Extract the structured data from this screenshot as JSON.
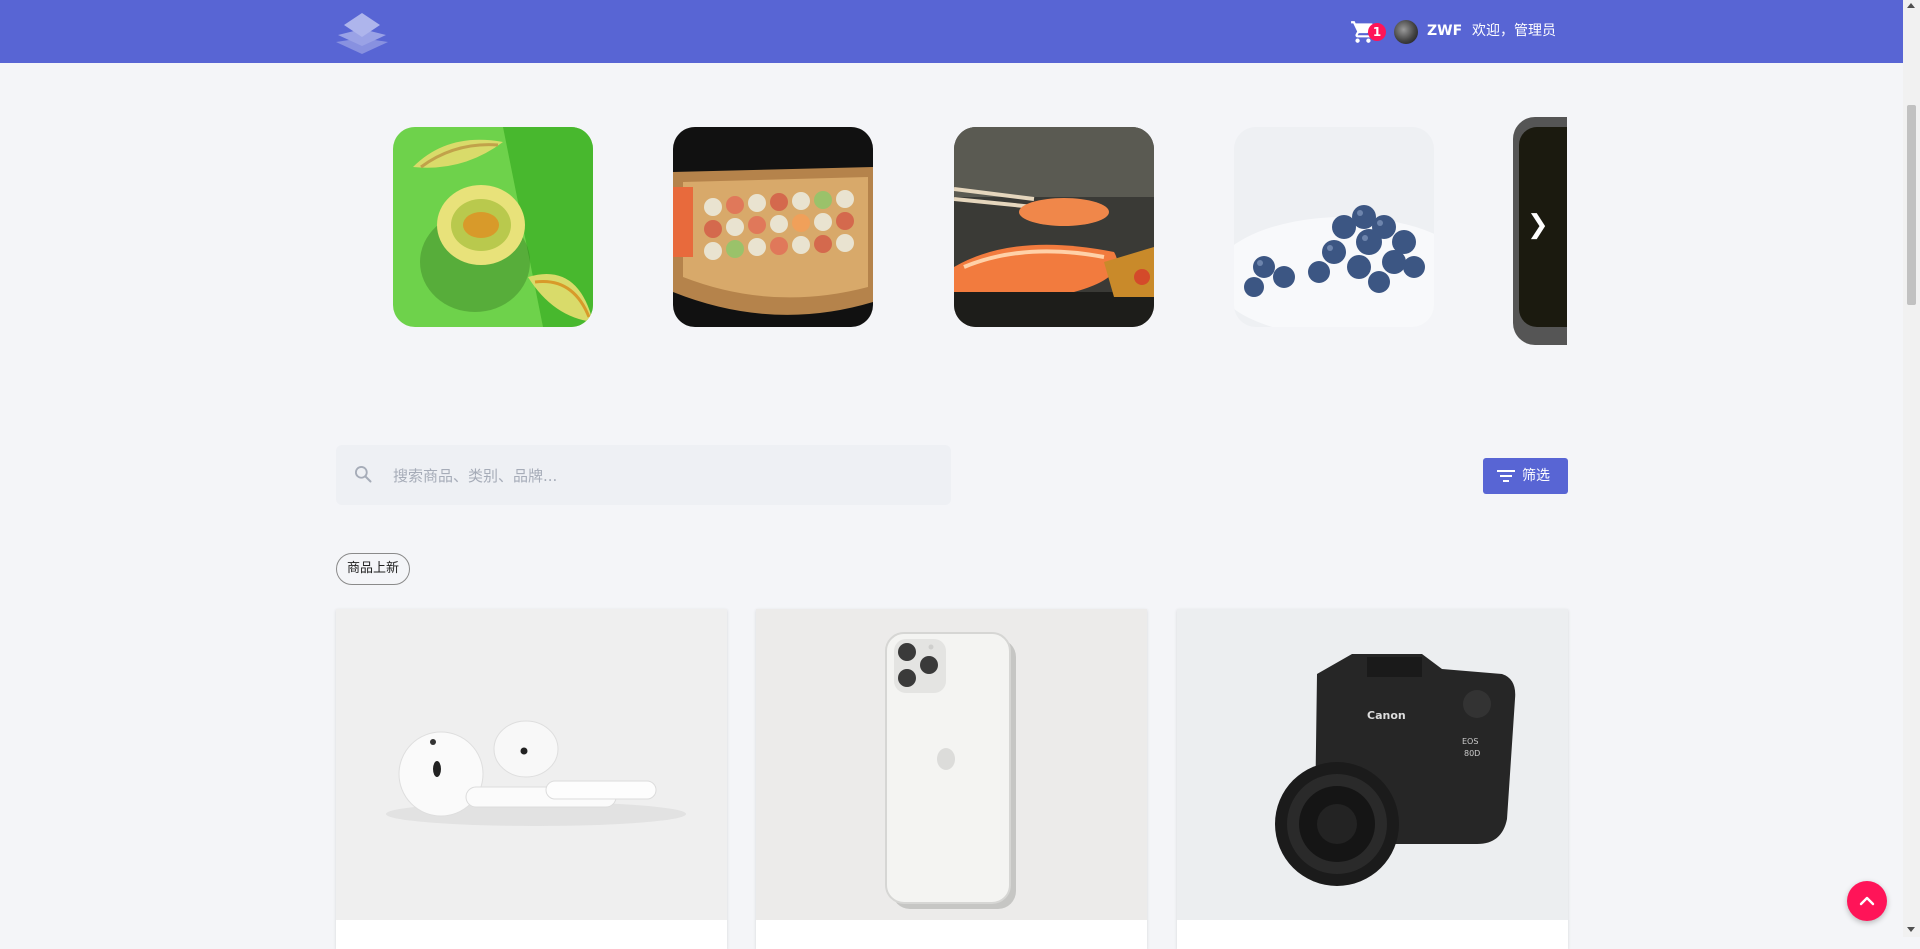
{
  "header": {
    "logo_icon": "layers-icon",
    "cart_icon": "cart-icon",
    "cart_count": "1",
    "username": "ZWF",
    "welcome_text": "欢迎，管理员",
    "bg_color": "#5865d4"
  },
  "carousel": {
    "items": [
      {
        "name": "melon-image"
      },
      {
        "name": "sushi-boat-image"
      },
      {
        "name": "salmon-sushi-image"
      },
      {
        "name": "blueberries-image"
      }
    ],
    "next_icon": "chevron-right-icon"
  },
  "search": {
    "placeholder": "搜索商品、类别、品牌...",
    "value": "",
    "icon": "search-icon"
  },
  "filter": {
    "label": "筛选",
    "icon": "filter-icon"
  },
  "section_chip": "商品上新",
  "products": [
    {
      "name": "airpods-image"
    },
    {
      "name": "iphone-image"
    },
    {
      "name": "canon-camera-image"
    }
  ],
  "back_to_top_icon": "arrow-up-icon",
  "colors": {
    "accent": "#5865d4",
    "badge": "#ff1458",
    "page_bg": "#f4f5f8"
  }
}
